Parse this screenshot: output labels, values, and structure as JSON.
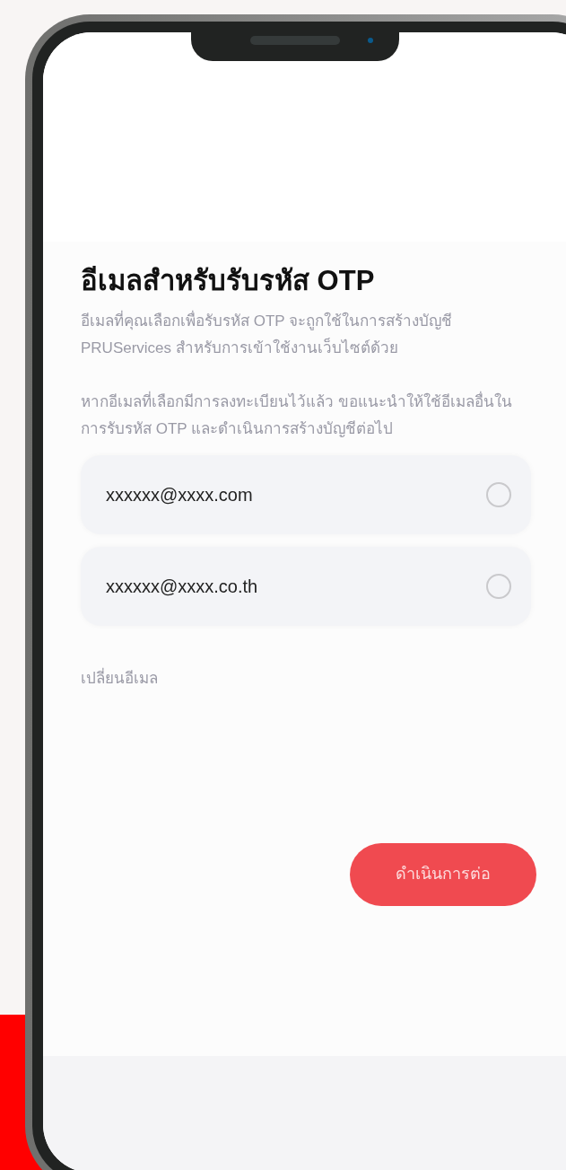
{
  "screen": {
    "title": "อีเมลสำหรับรับรหัส OTP",
    "paragraphs": [
      "อีเมลที่คุณเลือกเพื่อรับรหัส OTP จะถูกใช้ในการสร้างบัญชี PRUServices สำหรับการเข้าใช้งานเว็บไซต์ด้วย",
      "หากอีเมลที่เลือกมีการลงทะเบียนไว้แล้ว ขอแนะนำให้ใช้อีเมลอื่นในการรับรหัส OTP และดำเนินการสร้างบัญชีต่อไป"
    ],
    "email_options": [
      {
        "label": "xxxxxx@xxxx.com",
        "selected": false
      },
      {
        "label": "xxxxxx@xxxx.co.th",
        "selected": false
      }
    ],
    "change_email_link": "เปลี่ยนอีเมล",
    "continue_button": "ดำเนินการต่อ"
  }
}
